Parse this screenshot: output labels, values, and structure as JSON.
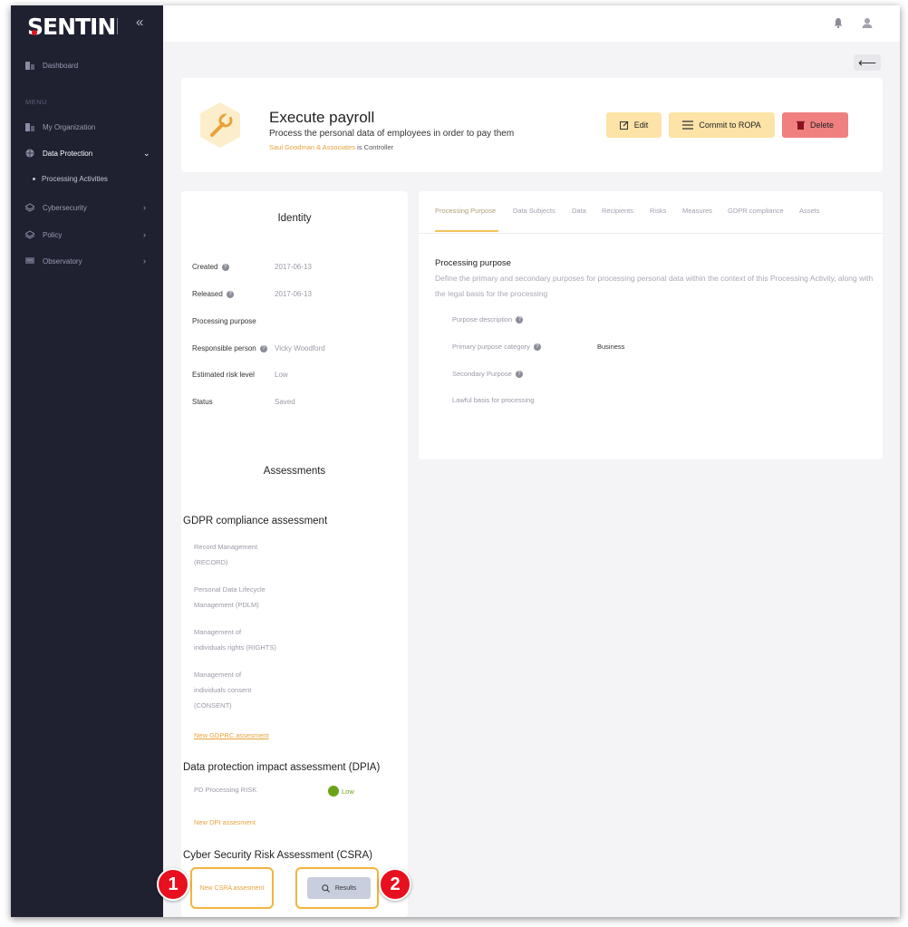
{
  "sidebar": {
    "brand": "SENTINEL",
    "collapse_icon": "«",
    "menu_label": "MENU",
    "dashboard": "Dashboard",
    "items": [
      {
        "label": "My Organization",
        "icon": "building-icon",
        "chevron": ""
      },
      {
        "label": "Data Protection",
        "icon": "globe-icon",
        "chevron": "⌄"
      },
      {
        "label": "Cybersecurity",
        "icon": "layers-icon",
        "chevron": "›"
      },
      {
        "label": "Policy",
        "icon": "layers-icon",
        "chevron": "›"
      },
      {
        "label": "Observatory",
        "icon": "monitor-icon",
        "chevron": "›"
      }
    ],
    "sub_item": "Processing Activities"
  },
  "topbar": {
    "bell_icon": "bell-icon",
    "user_icon": "user-icon"
  },
  "back_button": "⟵",
  "header": {
    "title": "Execute payroll",
    "description": "Process the personal data of employees in order to pay them",
    "controller_org": "Saul Goodman & Associates",
    "controller_suffix": " is Controller",
    "edit_label": "Edit",
    "commit_label": "Commit to ROPA",
    "delete_label": "Delete"
  },
  "identity": {
    "title": "Identity",
    "rows": [
      {
        "label": "Created",
        "help": true,
        "value": "2017-06-13"
      },
      {
        "label": "Released",
        "help": true,
        "value": "2017-06-13"
      },
      {
        "label": "Processing purpose",
        "help": false,
        "value": ""
      },
      {
        "label": "Responsible person",
        "help": true,
        "value": "Vicky Woodford"
      },
      {
        "label": "Estimated risk level",
        "help": false,
        "value": "Low"
      },
      {
        "label": "Status",
        "help": false,
        "value": "Saved"
      }
    ]
  },
  "assessments": {
    "title": "Assessments",
    "gdpr": {
      "heading": "GDPR compliance assessment",
      "items": [
        [
          "Record Management",
          "(RECORD)"
        ],
        [
          "Personal Data Lifecycle",
          "Management (PDLM)"
        ],
        [
          "Management of",
          "individuals rights (RIGHTS)"
        ],
        [
          "Management of",
          "individuals consent",
          "(CONSENT)"
        ]
      ],
      "new_link": "New GDPRC assesment"
    },
    "dpia": {
      "heading": "Data protection impact assessment (DPIA)",
      "risk_label": "PD Processing RISK",
      "risk_value": "Low",
      "risk_color": "#6aa31a",
      "new_link": "New DPI assesment"
    },
    "csra": {
      "heading": "Cyber Security Risk Assessment (CSRA)",
      "new_link": "New CSRA assesment",
      "results_label": "Results"
    }
  },
  "tabs": [
    "Processing Purpose",
    "Data Subjects",
    "Data",
    "Recipients",
    "Risks",
    "Measures",
    "GDPR compliance",
    "Assets"
  ],
  "purpose": {
    "title": "Processing purpose",
    "description": "Define the primary and secondary purposes for processing personal data within the context of this Processing Activity, along with the legal basis for the processing",
    "fields": [
      {
        "label": "Purpose description",
        "help": true,
        "value": ""
      },
      {
        "label": "Primary purpose category",
        "help": true,
        "value": "Business"
      },
      {
        "label": "Secondary Purpose",
        "help": true,
        "value": ""
      },
      {
        "label": "Lawful basis for processing",
        "help": false,
        "value": ""
      }
    ]
  },
  "callouts": [
    "1",
    "2"
  ],
  "colors": {
    "accent": "#e8a23a",
    "sidebar": "#1f2030",
    "delete": "#f08080",
    "edit": "#fde3a7",
    "callout": "#e8101e"
  }
}
